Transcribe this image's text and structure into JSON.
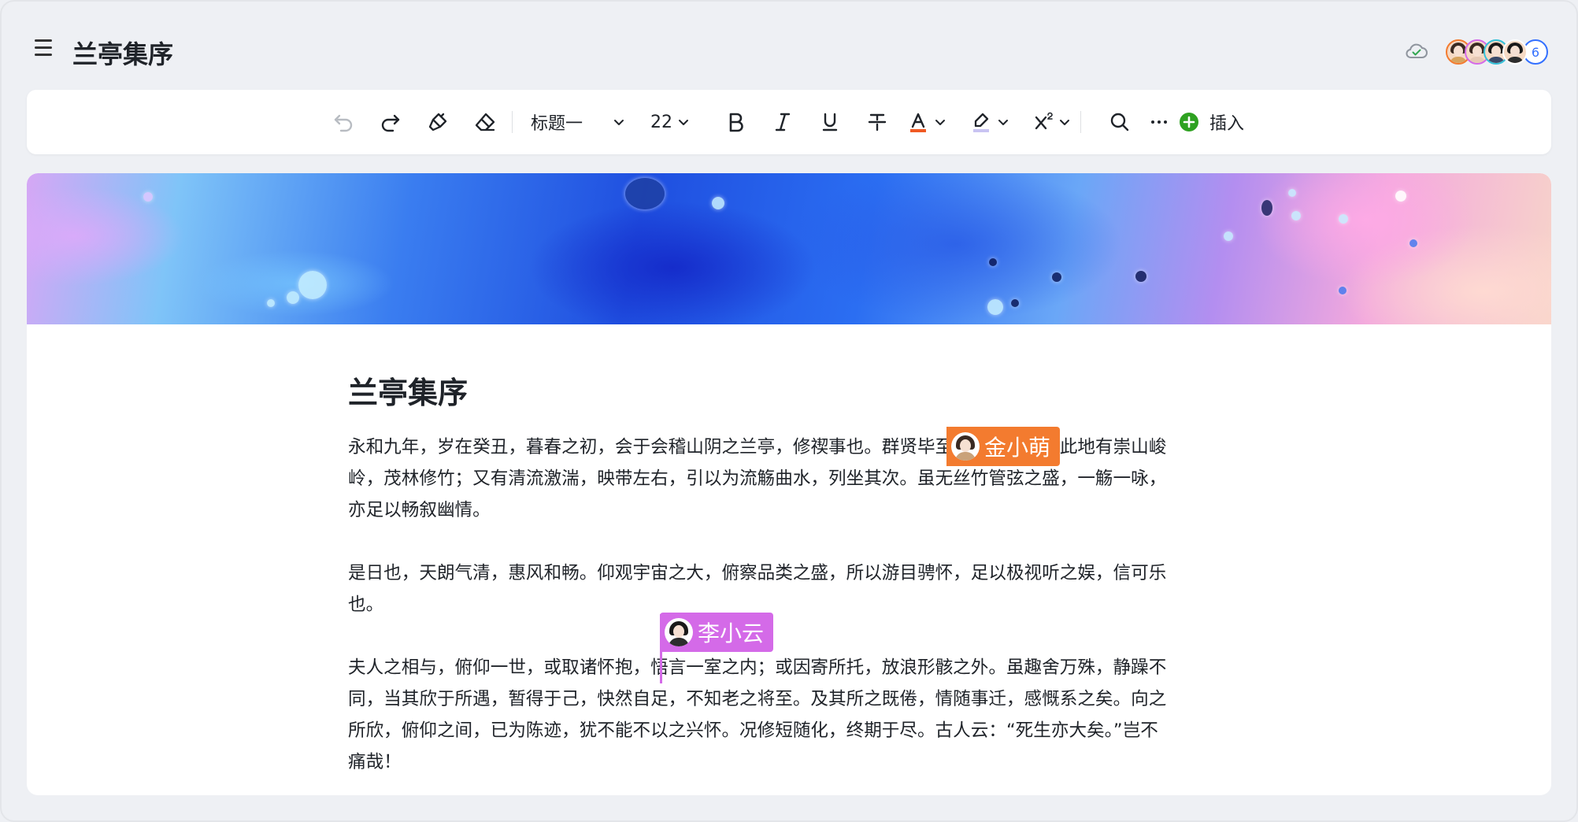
{
  "header": {
    "title": "兰亭集序",
    "collaborator_count": "6"
  },
  "toolbar": {
    "heading_style": "标题一",
    "font_size": "22",
    "insert_label": "插入"
  },
  "content": {
    "title": "兰亭集序",
    "paragraphs": [
      [
        "永和九年，岁在癸丑，暮春之初，会于会稽山阴之兰亭，修禊事也。群贤毕至，少长咸集。此地有崇山峻",
        "岭，茂林修竹；又有清流激湍，映带左右，引以为流觞曲水，列坐其次。虽无丝竹管弦之盛，一觞一咏，",
        "亦足以畅叙幽情。"
      ],
      [
        "是日也，天朗气清，惠风和畅。仰观宇宙之大，俯察品类之盛，所以游目骋怀，足以极视听之娱，信可乐",
        "也。"
      ],
      [
        "夫人之相与，俯仰一世，或取诸怀抱，悟言一室之内；或因寄所托，放浪形骸之外。虽趣舍万殊，静躁不",
        "同，当其欣于所遇，暂得于己，快然自足，不知老之将至。及其所之既倦，情随事迁，感慨系之矣。向之",
        "所欣，俯仰之间，已为陈迹，犹不能不以之兴怀。况修短随化，终期于尽。古人云：“死生亦大矣。”岂不",
        "痛哉！"
      ]
    ]
  },
  "collaborators": [
    {
      "name": "金小萌",
      "color": "#f37b2f"
    },
    {
      "name": "李小云",
      "color": "#d46ae8"
    }
  ],
  "colors": {
    "accent": "#3370ff",
    "insert_icon": "#2ea121",
    "font_color_bar": "#f05a24",
    "highlight_bar": "#c9c4f2"
  }
}
